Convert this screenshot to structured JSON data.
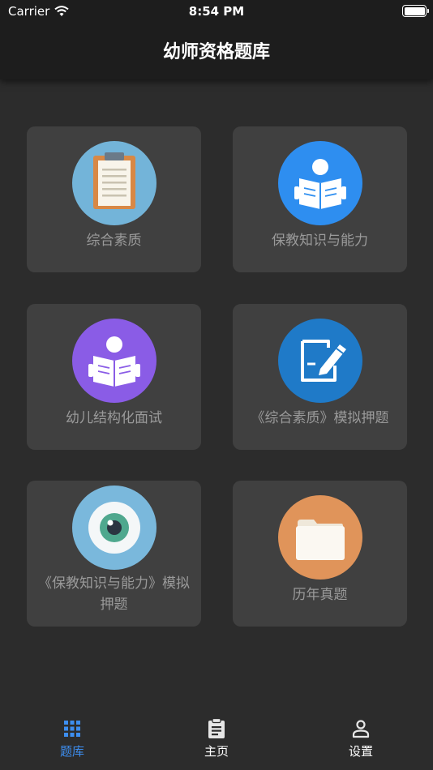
{
  "status_bar": {
    "carrier": "Carrier",
    "time": "8:54 PM"
  },
  "header": {
    "title": "幼师资格题库"
  },
  "cards": [
    {
      "label": "综合素质",
      "icon": "clipboard-icon",
      "color": "#73b4d9"
    },
    {
      "label": "保教知识与能力",
      "icon": "reader-icon",
      "color": "#2e8ef0"
    },
    {
      "label": "幼儿结构化面试",
      "icon": "reader-icon",
      "color": "#8a5ce6"
    },
    {
      "label": "《综合素质》模拟押题",
      "icon": "edit-document-icon",
      "color": "#1f7ac8"
    },
    {
      "label": "《保教知识与能力》模拟押题",
      "icon": "eye-icon",
      "color": "#7ab8dc"
    },
    {
      "label": "历年真题",
      "icon": "folder-icon",
      "color": "#e0945a"
    }
  ],
  "tabbar": {
    "items": [
      {
        "label": "题库",
        "icon": "grid-icon",
        "active": true
      },
      {
        "label": "主页",
        "icon": "clipboard-list-icon",
        "active": false
      },
      {
        "label": "设置",
        "icon": "person-icon",
        "active": false
      }
    ],
    "active_color": "#3d8ef0"
  }
}
